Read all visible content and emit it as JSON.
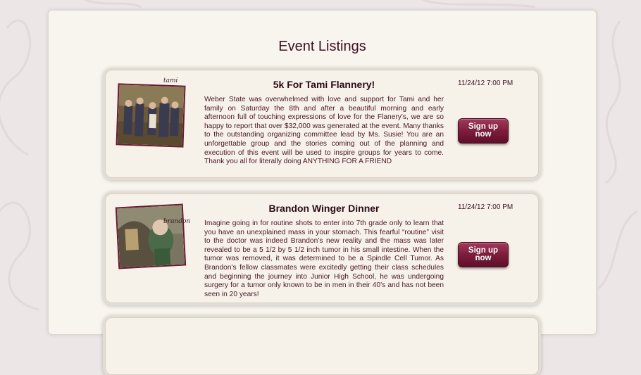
{
  "page": {
    "title": "Event Listings"
  },
  "colors": {
    "accent": "#6b1a33",
    "title_text": "#3d0f22",
    "body_text": "#4a1626",
    "panel": "#f8f5ef",
    "background": "#ece6e6"
  },
  "events": [
    {
      "title": "5k For Tami Flannery!",
      "photo_label": "tami",
      "description": "Weber State was overwhelmed with love and support for Tami and her family on Saturday the 8th and after a beautiful morning and early afternoon full of touching expressions of love for the Flanery's, we are so happy to report that over $32,000 was generated at the event. Many thanks to the outstanding organizing committee lead by Ms. Susie! You are an unforgettable group and the stories coming out of the planning and execution of this event will be used to inspire groups for years to come. Thank you all for literally doing ANYTHING FOR A FRIEND",
      "datetime": "11/24/12 7:00 PM",
      "signup_label": "Sign up now"
    },
    {
      "title": "Brandon Winger Dinner",
      "photo_label": "brandon",
      "description": "Imagine going in for routine shots to enter into 7th grade only to learn that you have an unexplained mass in your stomach. This fearful “routine” visit to the doctor was indeed Brandon’s new reality and the mass was later revealed to be a 5 1/2 by 5 1/2 inch tumor in his small intestine. When the tumor was removed, it was determined to be a Spindle Cell Tumor. As Brandon's fellow classmates were excitedly getting their class schedules and beginning the journey into Junior High School, he was undergoing surgery for a tumor only known to be in men in their 40’s and has not been seen in 20 years!",
      "datetime": "11/24/12 7:00 PM",
      "signup_label": "Sign up now"
    }
  ]
}
